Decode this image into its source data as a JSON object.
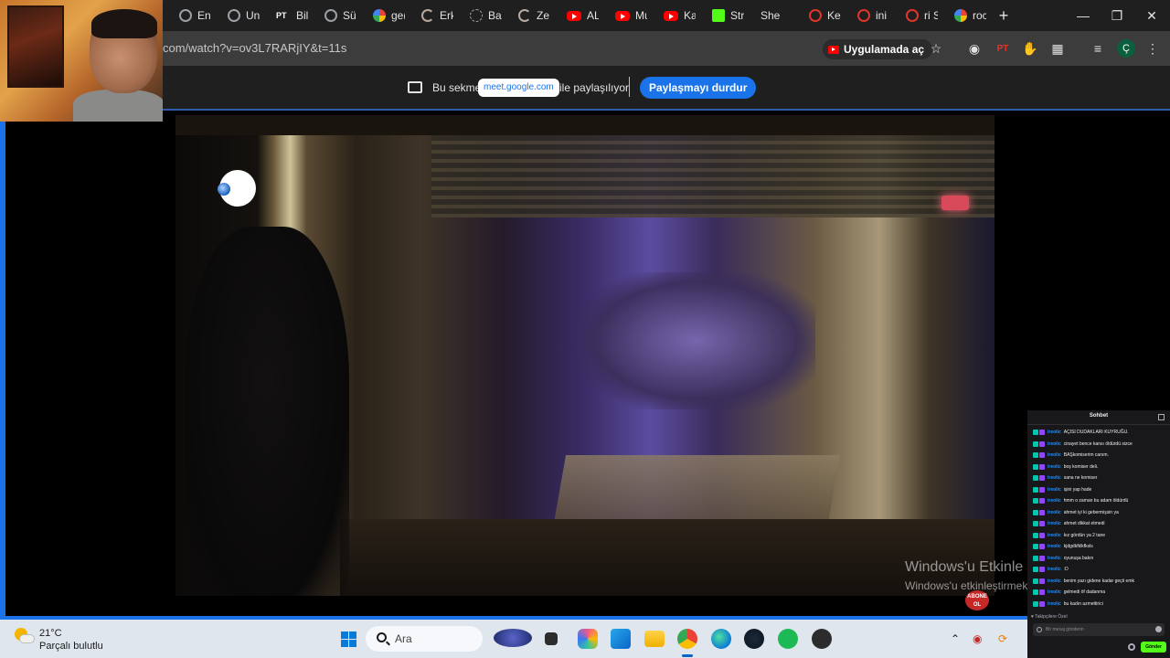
{
  "browser": {
    "tabs": [
      {
        "label": "En",
        "icon": "globe"
      },
      {
        "label": "Un",
        "icon": "globe"
      },
      {
        "label": "Bili",
        "icon": "pt"
      },
      {
        "label": "Sü;",
        "icon": "globe"
      },
      {
        "label": "ge(",
        "icon": "google"
      },
      {
        "label": "Erk",
        "icon": "swirl"
      },
      {
        "label": "Bal",
        "icon": "dots"
      },
      {
        "label": "Ze;",
        "icon": "swirl"
      },
      {
        "label": "AL/",
        "icon": "yt"
      },
      {
        "label": "Mu",
        "icon": "yt"
      },
      {
        "label": "Kar",
        "icon": "yt"
      },
      {
        "label": "Stre",
        "icon": "kick"
      },
      {
        "label": "She",
        "icon": "none"
      },
      {
        "label": "Ke;",
        "icon": "red-ring"
      },
      {
        "label": "ini",
        "icon": "red-ring"
      },
      {
        "label": "ri S",
        "icon": "red-ring"
      },
      {
        "label": "roc",
        "icon": "google"
      }
    ],
    "new_tab": "+",
    "url": "com/watch?v=ov3L7RARjIY&t=11s",
    "open_in_app": "Uygulamada aç",
    "profile_initial": "Ç",
    "pt_badge": "PT"
  },
  "share_banner": {
    "prefix": "Bu sekme",
    "domain": "meet.google.com",
    "suffix": "ile paylaşılıyor",
    "stop_button": "Paylaşmayı durdur"
  },
  "video": {
    "watermark_line1": "Windows'u Etkinle",
    "watermark_line2": "Windows'u etkinleştirmek",
    "subscribe_badge_line1": "ABONE",
    "subscribe_badge_line2": "OL"
  },
  "chat": {
    "title": "Sohbet",
    "messages": [
      {
        "user": "ireolic",
        "text": "AÇISI DUDAKLARI KUYRUĞU."
      },
      {
        "user": "ireolic",
        "text": "cinayet bence kansı öldürdü sizce"
      },
      {
        "user": "ireolic",
        "text": "BAŞkomiserim canım."
      },
      {
        "user": "ireolic",
        "text": "boş komiser deli."
      },
      {
        "user": "ireolic",
        "text": "sana ne komiser"
      },
      {
        "user": "ireolic",
        "text": "işini yap hade"
      },
      {
        "user": "ireolic",
        "text": "hmm o zaman bu adam öldürdü"
      },
      {
        "user": "ireolic",
        "text": "ahmet iyi ki gebermişsin ya"
      },
      {
        "user": "ireolic",
        "text": "ahmet dikkat etmedi"
      },
      {
        "user": "ireolic",
        "text": "kız gördün ya 2 tane"
      },
      {
        "user": "ireolic",
        "text": "kjdgdkfklkfksls"
      },
      {
        "user": "ireolic",
        "text": "oyunuşa bakın"
      },
      {
        "user": "ireolic",
        "text": ":D"
      },
      {
        "user": "ireolic",
        "text": "benim yazı gidene kadar geçti emk"
      },
      {
        "user": "ireolic",
        "text": "gelmedi öf dadanma"
      },
      {
        "user": "ireolic",
        "text": "bu kadın azmettirici"
      }
    ],
    "footer": "Takipçilere Özel",
    "input_placeholder": "Bir mesaj gönderin",
    "send_button": "Gönder"
  },
  "taskbar": {
    "temperature": "21°C",
    "condition": "Parçalı bulutlu",
    "search_placeholder": "Ara"
  }
}
